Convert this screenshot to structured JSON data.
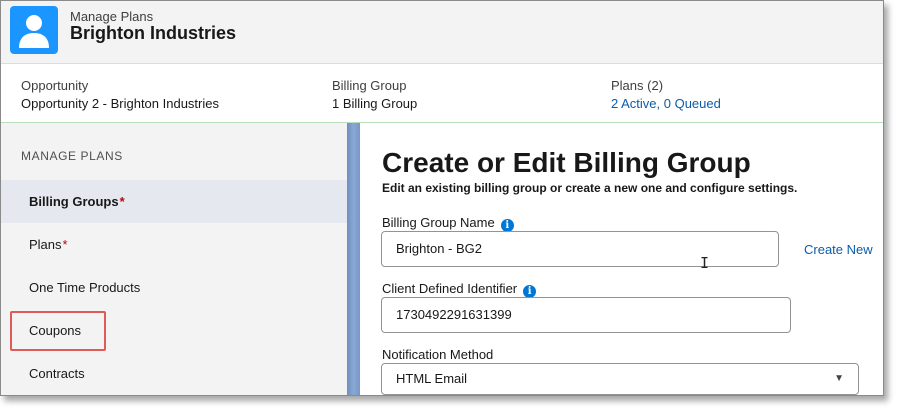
{
  "header": {
    "eyebrow": "Manage Plans",
    "title": "Brighton Industries",
    "avatar_icon": "user-icon",
    "avatar_color": "#1b96ff"
  },
  "highlights": [
    {
      "label": "Opportunity",
      "value": "Opportunity 2 - Brighton Industries",
      "is_link": false
    },
    {
      "label": "Billing Group",
      "value": "1 Billing Group",
      "is_link": false
    },
    {
      "label": "Plans (2)",
      "value": "2 Active, 0 Queued",
      "is_link": true
    }
  ],
  "sidebar": {
    "heading": "MANAGE PLANS",
    "items": [
      {
        "label": "Billing Groups",
        "required": "*",
        "active": true
      },
      {
        "label": "Plans",
        "required": "*",
        "active": false
      },
      {
        "label": "One Time Products",
        "required": "",
        "active": false
      },
      {
        "label": "Coupons",
        "required": "",
        "active": false,
        "highlighted": true
      },
      {
        "label": "Contracts",
        "required": "",
        "active": false
      }
    ]
  },
  "main": {
    "title": "Create or Edit Billing Group",
    "subtitle": "Edit an existing billing group or create a new one and configure settings.",
    "fields": {
      "billing_group_name": {
        "label": "Billing Group Name",
        "value": "Brighton - BG2",
        "info_icon": "info-icon"
      },
      "client_identifier": {
        "label": "Client Defined Identifier",
        "value": "1730492291631399",
        "info_icon": "info-icon"
      },
      "notification_method": {
        "label": "Notification Method",
        "value": "HTML Email"
      }
    },
    "create_new_label": "Create New"
  },
  "colors": {
    "link": "#0b5cab",
    "required": "#ba0517",
    "info": "#0176d3",
    "highlight_box": "#e05a5a"
  }
}
